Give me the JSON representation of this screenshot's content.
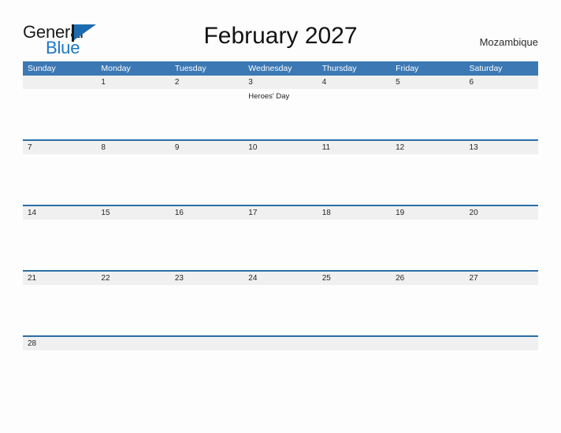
{
  "brand": {
    "name_part1": "General",
    "name_part2": "Blue",
    "flag_icon": "flag-icon",
    "accent_dark_blue": "#1d6cb0",
    "accent_light_blue": "#1d77c4"
  },
  "header": {
    "title": "February 2027",
    "country": "Mozambique"
  },
  "theme": {
    "header_blue": "#3b78b4",
    "row_divider_blue": "#2a6fa8",
    "day_band_gray": "#f0f0f0",
    "page_background": "#fdfdfd"
  },
  "calendar": {
    "weekdays": [
      "Sunday",
      "Monday",
      "Tuesday",
      "Wednesday",
      "Thursday",
      "Friday",
      "Saturday"
    ],
    "weeks": [
      [
        {
          "day": "",
          "event": ""
        },
        {
          "day": "1",
          "event": ""
        },
        {
          "day": "2",
          "event": ""
        },
        {
          "day": "3",
          "event": "Heroes' Day"
        },
        {
          "day": "4",
          "event": ""
        },
        {
          "day": "5",
          "event": ""
        },
        {
          "day": "6",
          "event": ""
        }
      ],
      [
        {
          "day": "7",
          "event": ""
        },
        {
          "day": "8",
          "event": ""
        },
        {
          "day": "9",
          "event": ""
        },
        {
          "day": "10",
          "event": ""
        },
        {
          "day": "11",
          "event": ""
        },
        {
          "day": "12",
          "event": ""
        },
        {
          "day": "13",
          "event": ""
        }
      ],
      [
        {
          "day": "14",
          "event": ""
        },
        {
          "day": "15",
          "event": ""
        },
        {
          "day": "16",
          "event": ""
        },
        {
          "day": "17",
          "event": ""
        },
        {
          "day": "18",
          "event": ""
        },
        {
          "day": "19",
          "event": ""
        },
        {
          "day": "20",
          "event": ""
        }
      ],
      [
        {
          "day": "21",
          "event": ""
        },
        {
          "day": "22",
          "event": ""
        },
        {
          "day": "23",
          "event": ""
        },
        {
          "day": "24",
          "event": ""
        },
        {
          "day": "25",
          "event": ""
        },
        {
          "day": "26",
          "event": ""
        },
        {
          "day": "27",
          "event": ""
        }
      ],
      [
        {
          "day": "28",
          "event": ""
        },
        {
          "day": "",
          "event": ""
        },
        {
          "day": "",
          "event": ""
        },
        {
          "day": "",
          "event": ""
        },
        {
          "day": "",
          "event": ""
        },
        {
          "day": "",
          "event": ""
        },
        {
          "day": "",
          "event": ""
        }
      ]
    ]
  }
}
